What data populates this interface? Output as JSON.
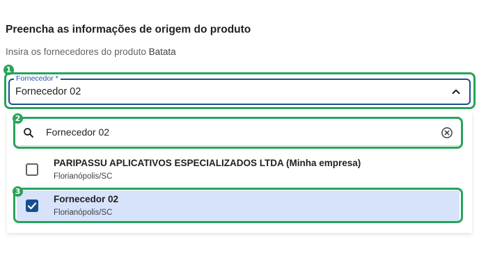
{
  "header": {
    "title": "Preencha as informações de origem do produto",
    "subtitle_prefix": "Insira os fornecedores do produto",
    "product_name": "Batata"
  },
  "supplier_field": {
    "label": "Fornecedor *",
    "value": "Fornecedor 02",
    "icon": "chevron-up-icon"
  },
  "dropdown": {
    "search": {
      "value": "Fornecedor 02",
      "icon": "search-icon",
      "clear_icon": "clear-icon"
    },
    "options": [
      {
        "title": "PARIPASSU APLICATIVOS ESPECIALIZADOS LTDA (Minha empresa)",
        "location": "Florianópolis/SC",
        "checked": false
      },
      {
        "title": "Fornecedor 02",
        "location": "Florianópolis/SC",
        "checked": true
      }
    ]
  },
  "callouts": [
    "1",
    "2",
    "3"
  ],
  "colors": {
    "callout": "#27a45a",
    "accent": "#1a4d8f",
    "selected_bg": "#d6e3fb"
  }
}
